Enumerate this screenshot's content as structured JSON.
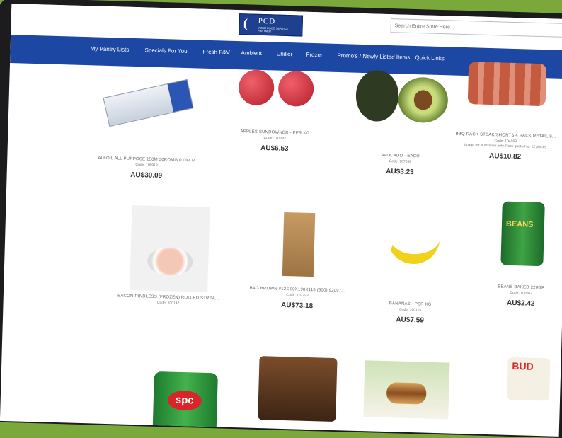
{
  "site": {
    "logo_name": "PCD",
    "logo_tagline": "YOUR FOOD SERVICE PARTNER",
    "search_placeholder": "Search Entire Store Here..."
  },
  "nav": [
    {
      "label": "My Pantry Lists"
    },
    {
      "label": "Specials For You"
    },
    {
      "label": "Fresh F&V"
    },
    {
      "label": "Ambient"
    },
    {
      "label": "Chiller"
    },
    {
      "label": "Frozen"
    },
    {
      "label": "Promo's / Newly Listed Items"
    },
    {
      "label": "Quick Links"
    }
  ],
  "products": [
    {
      "name": "ALFOIL ALL PURPOSE 150M 30ROMG 0.0IM M",
      "code": "Code: 100913",
      "note": "",
      "price": "AU$30.09",
      "icon": "foil-roll"
    },
    {
      "name": "APPLES SUNDOWNER - PER KG",
      "code": "Code: 107282",
      "note": "",
      "price": "AU$6.53",
      "icon": "apples"
    },
    {
      "name": "AVOCADO - EACH",
      "code": "Code: 107208",
      "note": "",
      "price": "AU$3.23",
      "icon": "avocado"
    },
    {
      "name": "BBQ RACK STEAK/SHORTS 4 BACK RETAIL 9...",
      "code": "Code: 104869",
      "note": "Image for illustration only. Pack quoted for 12 pieces",
      "price": "AU$10.82",
      "icon": "meat"
    },
    {
      "name": "BACON RINDLESS (FROZEN) ROLLED STREA...",
      "code": "Code: 100142",
      "note": "",
      "price": "",
      "icon": "bacon"
    },
    {
      "name": "BAG BROWN #12 390X190X115 (500) 92097...",
      "code": "Code: 107793",
      "note": "",
      "price": "AU$73.18",
      "icon": "paper-bag"
    },
    {
      "name": "BANANAS - PER KG",
      "code": "Code: 100115",
      "note": "",
      "price": "AU$7.59",
      "icon": "bananas"
    },
    {
      "name": "BEANS BAKED 220GR",
      "code": "Code: 100602",
      "note": "",
      "price": "AU$2.42",
      "icon": "beans-can"
    },
    {
      "name": "",
      "code": "",
      "note": "",
      "price": "",
      "icon": "spc-can"
    },
    {
      "name": "",
      "code": "",
      "note": "",
      "price": "",
      "icon": "platter"
    },
    {
      "name": "",
      "code": "",
      "note": "",
      "price": "",
      "icon": "burger"
    },
    {
      "name": "",
      "code": "",
      "note": "",
      "price": "",
      "icon": "buddy-pack"
    }
  ]
}
